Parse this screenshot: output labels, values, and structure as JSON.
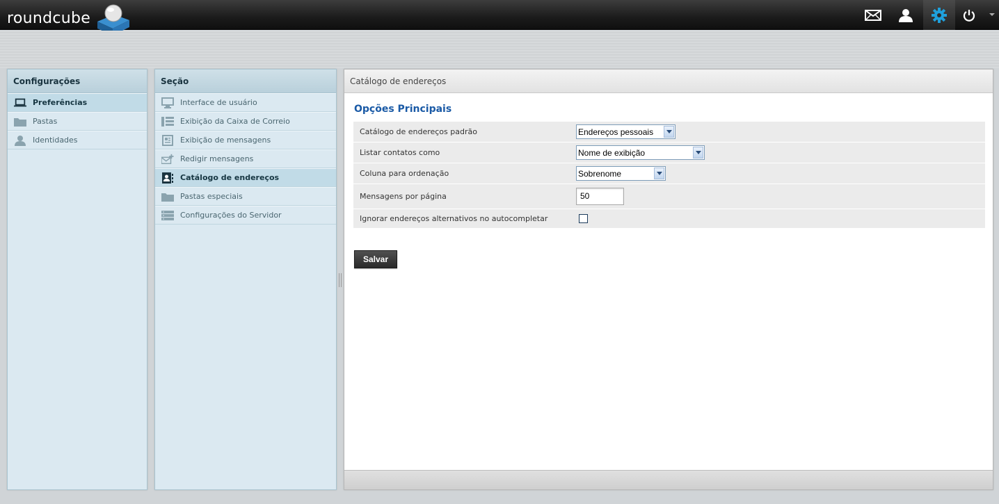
{
  "app": {
    "logo_text": "roundcube",
    "accent_color": "#1fa0dc"
  },
  "topnav": {
    "items": [
      {
        "name": "mail",
        "icon": "envelope-icon",
        "active": false
      },
      {
        "name": "contacts",
        "icon": "person-icon",
        "active": false
      },
      {
        "name": "settings",
        "icon": "gear-icon",
        "active": true
      },
      {
        "name": "logout",
        "icon": "power-icon",
        "active": false
      }
    ],
    "menu_icon": "caret-down-icon"
  },
  "settings_panel": {
    "title": "Configurações",
    "items": [
      {
        "label": "Preferências",
        "icon": "laptop-icon",
        "selected": true
      },
      {
        "label": "Pastas",
        "icon": "folder-icon",
        "selected": false
      },
      {
        "label": "Identidades",
        "icon": "person-icon",
        "selected": false
      }
    ]
  },
  "section_panel": {
    "title": "Seção",
    "items": [
      {
        "label": "Interface de usuário",
        "icon": "monitor-icon",
        "selected": false
      },
      {
        "label": "Exibição da Caixa de Correio",
        "icon": "list-layout-icon",
        "selected": false
      },
      {
        "label": "Exibição de mensagens",
        "icon": "message-view-icon",
        "selected": false
      },
      {
        "label": "Redigir mensagens",
        "icon": "compose-icon",
        "selected": false
      },
      {
        "label": "Catálogo de endereços",
        "icon": "address-book-icon",
        "selected": true
      },
      {
        "label": "Pastas especiais",
        "icon": "folder-icon",
        "selected": false
      },
      {
        "label": "Configurações do Servidor",
        "icon": "server-icon",
        "selected": false
      }
    ]
  },
  "content": {
    "header": "Catálogo de endereços",
    "fieldset_legend": "Opções Principais",
    "rows": [
      {
        "label": "Catálogo de endereços padrão",
        "control": "select",
        "value": "Endereços pessoais"
      },
      {
        "label": "Listar contatos como",
        "control": "select",
        "value": "Nome de exibição"
      },
      {
        "label": "Coluna para ordenação",
        "control": "select",
        "value": "Sobrenome"
      },
      {
        "label": "Mensagens por página",
        "control": "text",
        "value": "50"
      },
      {
        "label": "Ignorar endereços alternativos no autocompletar",
        "control": "checkbox",
        "checked": false
      }
    ],
    "save_label": "Salvar"
  }
}
